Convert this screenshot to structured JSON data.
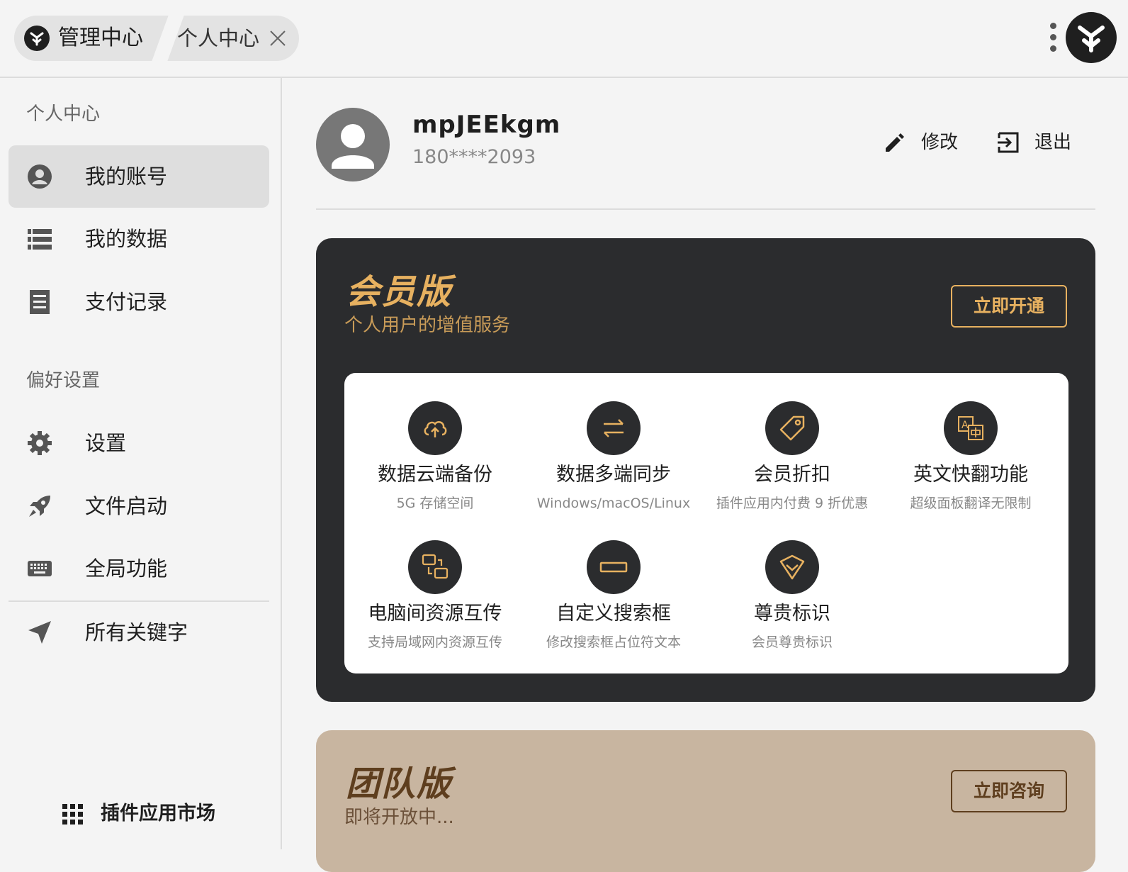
{
  "header": {
    "tabs": [
      {
        "label": "管理中心",
        "icon": "app-logo-icon"
      },
      {
        "label": "个人中心",
        "icon": "close-icon"
      }
    ],
    "menu_icon": "more-vertical-icon",
    "logo_icon": "app-logo-icon"
  },
  "sidebar": {
    "section1": "个人中心",
    "section2": "偏好设置",
    "items": [
      {
        "label": "我的账号",
        "icon": "account-circle-icon",
        "active": true
      },
      {
        "label": "我的数据",
        "icon": "list-icon"
      },
      {
        "label": "支付记录",
        "icon": "receipt-icon"
      },
      {
        "label": "设置",
        "icon": "gear-icon"
      },
      {
        "label": "文件启动",
        "icon": "rocket-icon"
      },
      {
        "label": "全局功能",
        "icon": "keyboard-icon"
      },
      {
        "label": "所有关键字",
        "icon": "send-icon"
      }
    ],
    "market_label": "插件应用市场",
    "market_icon": "grid-icon"
  },
  "profile": {
    "username": "mpJEEkgm",
    "phone": "180****2093",
    "edit_label": "修改",
    "logout_label": "退出"
  },
  "vip": {
    "title": "会员版",
    "subtitle": "个人用户的增值服务",
    "button": "立即开通",
    "accent": "#e7b160",
    "features": [
      {
        "title": "数据云端备份",
        "desc": "5G 存储空间",
        "icon": "cloud-upload-icon"
      },
      {
        "title": "数据多端同步",
        "desc": "Windows/macOS/Linux",
        "icon": "sync-arrows-icon"
      },
      {
        "title": "会员折扣",
        "desc": "插件应用内付费 9 折优惠",
        "icon": "tag-icon"
      },
      {
        "title": "英文快翻功能",
        "desc": "超级面板翻译无限制",
        "icon": "translate-icon"
      },
      {
        "title": "电脑间资源互传",
        "desc": "支持局域网内资源互传",
        "icon": "devices-transfer-icon"
      },
      {
        "title": "自定义搜索框",
        "desc": "修改搜索框占位符文本",
        "icon": "search-box-icon"
      },
      {
        "title": "尊贵标识",
        "desc": "会员尊贵标识",
        "icon": "diamond-icon"
      }
    ]
  },
  "team": {
    "title": "团队版",
    "subtitle": "即将开放中...",
    "button": "立即咨询"
  }
}
